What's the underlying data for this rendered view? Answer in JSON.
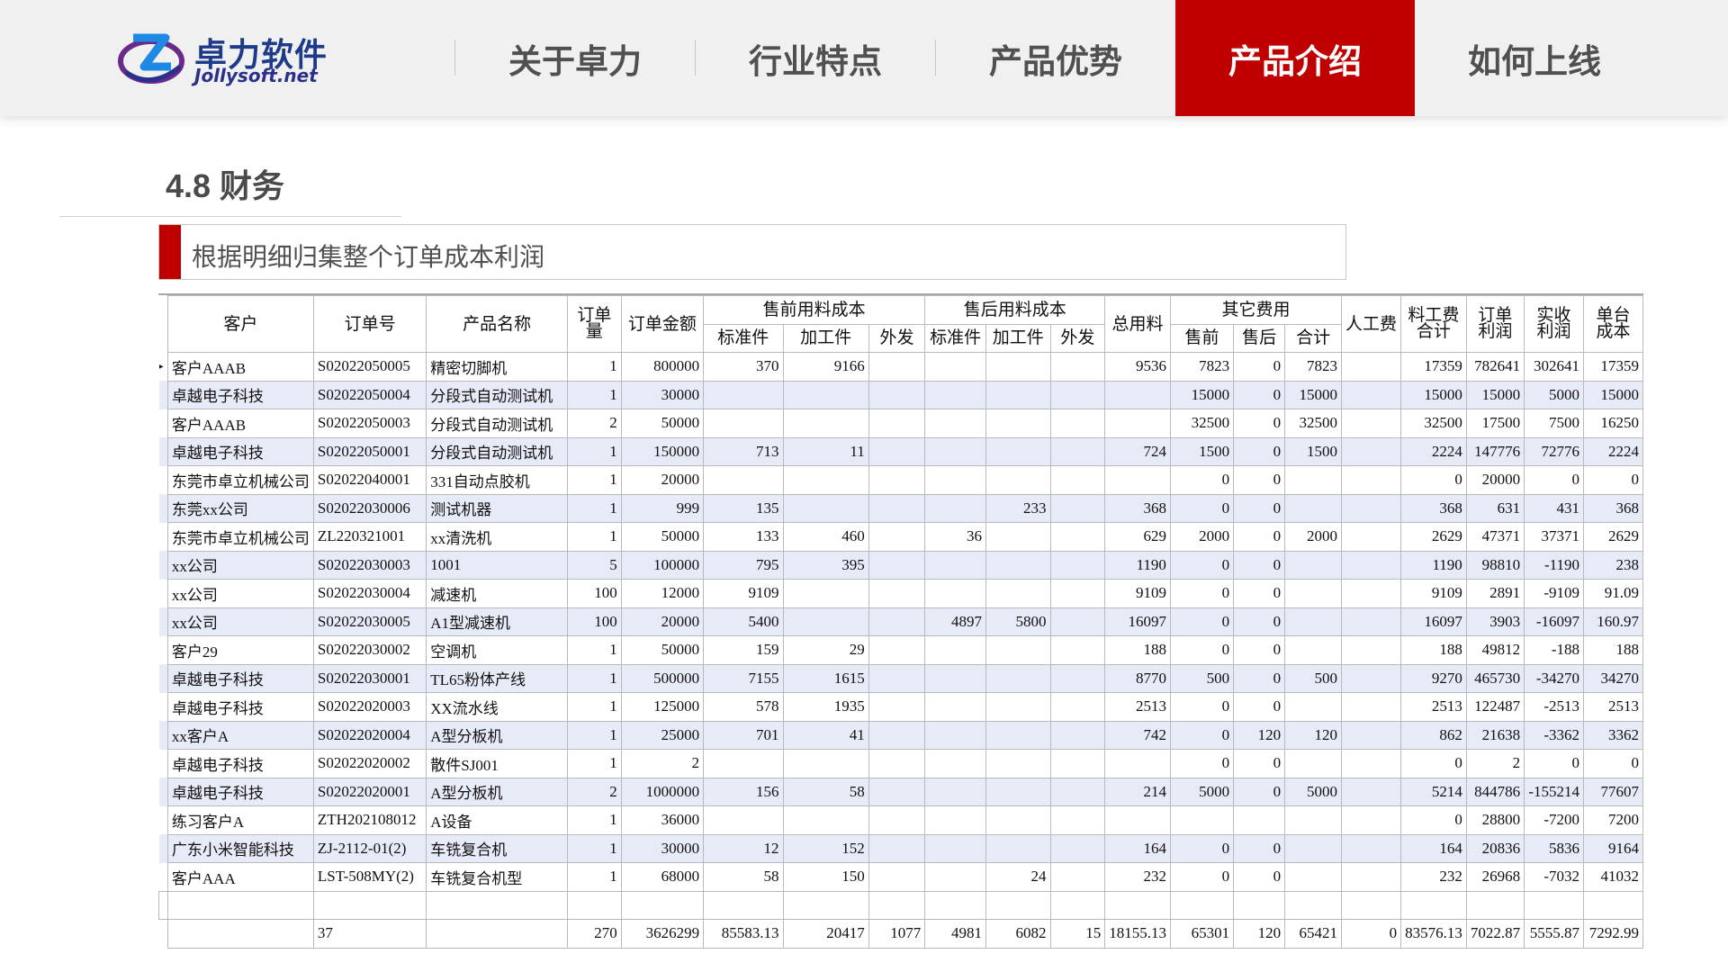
{
  "logo": {
    "cn": "卓力软件",
    "en": "Jollysoft.net",
    "mark": "Z"
  },
  "nav": {
    "items": [
      {
        "label": "关于卓力",
        "active": false
      },
      {
        "label": "行业特点",
        "active": false
      },
      {
        "label": "产品优势",
        "active": false
      },
      {
        "label": "产品介绍",
        "active": true
      },
      {
        "label": "如何上线",
        "active": false
      }
    ]
  },
  "section": {
    "title": "4.8 财务",
    "subtitle": "根据明细归集整个订单成本利润"
  },
  "table": {
    "headers": {
      "customer": "客户",
      "order_no": "订单号",
      "product": "产品名称",
      "qty": "订单量",
      "amount": "订单金额",
      "pre_group": "售前用料成本",
      "post_group": "售后用料成本",
      "total_material": "总用料",
      "other_group": "其它费用",
      "labor": "人工费",
      "material_labor_total": "料工费合计",
      "order_profit": "订单利润",
      "actual_profit": "实收利润",
      "unit_cost": "单台成本",
      "standard": "标准件",
      "processed": "加工件",
      "outsourced": "外发",
      "pre_sale": "售前",
      "after_sale": "售后",
      "subtotal": "合计"
    },
    "rows": [
      [
        "客户AAAB",
        "S02022050005",
        "精密切脚机",
        "1",
        "800000",
        "370",
        "9166",
        "",
        "",
        "",
        "",
        "9536",
        "7823",
        "0",
        "7823",
        "",
        "17359",
        "782641",
        "302641",
        "17359"
      ],
      [
        "卓越电子科技",
        "S02022050004",
        "分段式自动测试机",
        "1",
        "30000",
        "",
        "",
        "",
        "",
        "",
        "",
        "",
        "15000",
        "0",
        "15000",
        "",
        "15000",
        "15000",
        "5000",
        "15000"
      ],
      [
        "客户AAAB",
        "S02022050003",
        "分段式自动测试机",
        "2",
        "50000",
        "",
        "",
        "",
        "",
        "",
        "",
        "",
        "32500",
        "0",
        "32500",
        "",
        "32500",
        "17500",
        "7500",
        "16250"
      ],
      [
        "卓越电子科技",
        "S02022050001",
        "分段式自动测试机",
        "1",
        "150000",
        "713",
        "11",
        "",
        "",
        "",
        "",
        "724",
        "1500",
        "0",
        "1500",
        "",
        "2224",
        "147776",
        "72776",
        "2224"
      ],
      [
        "东莞市卓立机械公司",
        "S02022040001",
        "331自动点胶机",
        "1",
        "20000",
        "",
        "",
        "",
        "",
        "",
        "",
        "",
        "0",
        "0",
        "",
        "",
        "0",
        "20000",
        "0",
        "0"
      ],
      [
        "东莞xx公司",
        "S02022030006",
        "测试机器",
        "1",
        "999",
        "135",
        "",
        "",
        "",
        "233",
        "",
        "368",
        "0",
        "0",
        "",
        "",
        "368",
        "631",
        "431",
        "368"
      ],
      [
        "东莞市卓立机械公司",
        "ZL220321001",
        "xx清洗机",
        "1",
        "50000",
        "133",
        "460",
        "",
        "36",
        "",
        "",
        "629",
        "2000",
        "0",
        "2000",
        "",
        "2629",
        "47371",
        "37371",
        "2629"
      ],
      [
        "xx公司",
        "S02022030003",
        "1001",
        "5",
        "100000",
        "795",
        "395",
        "",
        "",
        "",
        "",
        "1190",
        "0",
        "0",
        "",
        "",
        "1190",
        "98810",
        "-1190",
        "238"
      ],
      [
        "xx公司",
        "S02022030004",
        "减速机",
        "100",
        "12000",
        "9109",
        "",
        "",
        "",
        "",
        "",
        "9109",
        "0",
        "0",
        "",
        "",
        "9109",
        "2891",
        "-9109",
        "91.09"
      ],
      [
        "xx公司",
        "S02022030005",
        "A1型减速机",
        "100",
        "20000",
        "5400",
        "",
        "",
        "4897",
        "5800",
        "",
        "16097",
        "0",
        "0",
        "",
        "",
        "16097",
        "3903",
        "-16097",
        "160.97"
      ],
      [
        "客户29",
        "S02022030002",
        "空调机",
        "1",
        "50000",
        "159",
        "29",
        "",
        "",
        "",
        "",
        "188",
        "0",
        "0",
        "",
        "",
        "188",
        "49812",
        "-188",
        "188"
      ],
      [
        "卓越电子科技",
        "S02022030001",
        "TL65粉体产线",
        "1",
        "500000",
        "7155",
        "1615",
        "",
        "",
        "",
        "",
        "8770",
        "500",
        "0",
        "500",
        "",
        "9270",
        "465730",
        "-34270",
        "34270"
      ],
      [
        "卓越电子科技",
        "S02022020003",
        "XX流水线",
        "1",
        "125000",
        "578",
        "1935",
        "",
        "",
        "",
        "",
        "2513",
        "0",
        "0",
        "",
        "",
        "2513",
        "122487",
        "-2513",
        "2513"
      ],
      [
        "xx客户A",
        "S02022020004",
        "A型分板机",
        "1",
        "25000",
        "701",
        "41",
        "",
        "",
        "",
        "",
        "742",
        "0",
        "120",
        "120",
        "",
        "862",
        "21638",
        "-3362",
        "3362"
      ],
      [
        "卓越电子科技",
        "S02022020002",
        "散件SJ001",
        "1",
        "2",
        "",
        "",
        "",
        "",
        "",
        "",
        "",
        "0",
        "0",
        "",
        "",
        "0",
        "2",
        "0",
        "0"
      ],
      [
        "卓越电子科技",
        "S02022020001",
        "A型分板机",
        "2",
        "1000000",
        "156",
        "58",
        "",
        "",
        "",
        "",
        "214",
        "5000",
        "0",
        "5000",
        "",
        "5214",
        "844786",
        "-155214",
        "77607"
      ],
      [
        "练习客户A",
        "ZTH202108012",
        "A设备",
        "1",
        "36000",
        "",
        "",
        "",
        "",
        "",
        "",
        "",
        "",
        "",
        "",
        "",
        "0",
        "28800",
        "-7200",
        "7200"
      ],
      [
        "广东小米智能科技",
        "ZJ-2112-01(2)",
        "车铣复合机",
        "1",
        "30000",
        "12",
        "152",
        "",
        "",
        "",
        "",
        "164",
        "0",
        "0",
        "",
        "",
        "164",
        "20836",
        "5836",
        "9164"
      ],
      [
        "客户AAA",
        "LST-508MY(2)",
        "车铣复合机型",
        "1",
        "68000",
        "58",
        "150",
        "",
        "",
        "24",
        "",
        "232",
        "0",
        "0",
        "",
        "",
        "232",
        "26968",
        "-7032",
        "41032"
      ]
    ],
    "summary": [
      "",
      "37",
      "",
      "270",
      "3626299",
      "85583.13",
      "20417",
      "1077",
      "4981",
      "6082",
      "15",
      "18155.13",
      "65301",
      "120",
      "65421",
      "0",
      "83576.13",
      "7022.87",
      "5555.87",
      "7292.99"
    ]
  }
}
